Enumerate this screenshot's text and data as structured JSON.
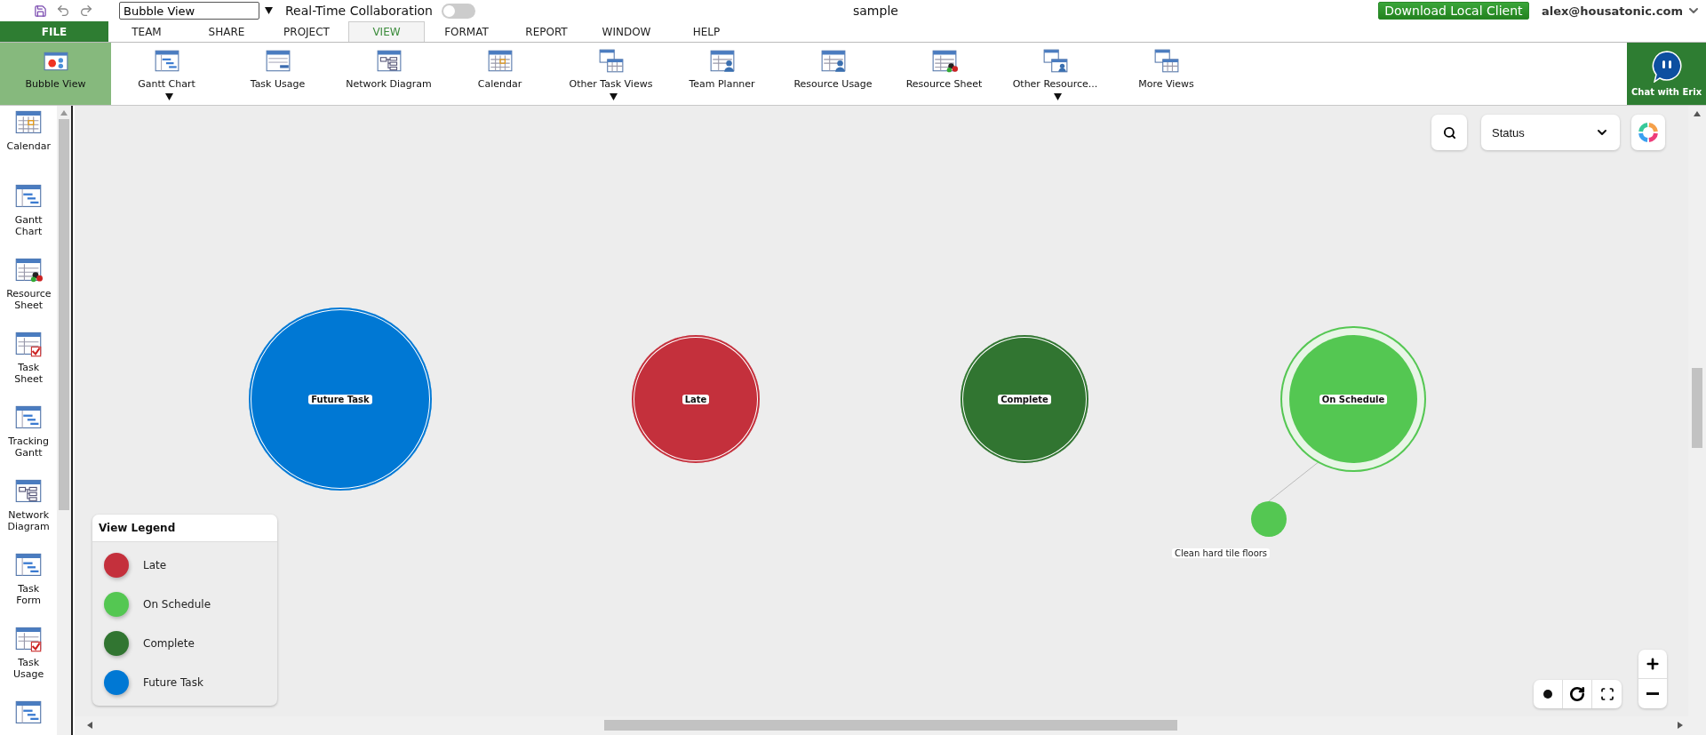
{
  "toolbar": {
    "document_name": "Bubble View",
    "collaboration_label": "Real-Time Collaboration",
    "collaboration_on": false
  },
  "title": "sample",
  "download_button": "Download Local Client",
  "user": "alex@housatonic.com",
  "menu_tabs": [
    {
      "label": "FILE",
      "kind": "file",
      "selected": false
    },
    {
      "label": "TEAM",
      "kind": "tab",
      "selected": false
    },
    {
      "label": "SHARE",
      "kind": "tab",
      "selected": false
    },
    {
      "label": "PROJECT",
      "kind": "tab",
      "selected": false
    },
    {
      "label": "VIEW",
      "kind": "tab",
      "selected": true
    },
    {
      "label": "FORMAT",
      "kind": "tab",
      "selected": false
    },
    {
      "label": "REPORT",
      "kind": "tab",
      "selected": false
    },
    {
      "label": "WINDOW",
      "kind": "tab",
      "selected": false
    },
    {
      "label": "HELP",
      "kind": "tab",
      "selected": false
    }
  ],
  "ribbon": [
    {
      "label": "Bubble View",
      "kind": "bubble",
      "selected": true,
      "dropdown": false
    },
    {
      "label": "Gantt Chart",
      "kind": "gantt",
      "selected": false,
      "dropdown": true
    },
    {
      "label": "Task Usage",
      "kind": "usage",
      "selected": false,
      "dropdown": false
    },
    {
      "label": "Network Diagram",
      "kind": "network",
      "selected": false,
      "dropdown": false
    },
    {
      "label": "Calendar",
      "kind": "calendar",
      "selected": false,
      "dropdown": false
    },
    {
      "label": "Other Task Views",
      "kind": "stack",
      "selected": false,
      "dropdown": true
    },
    {
      "label": "Team Planner",
      "kind": "team",
      "selected": false,
      "dropdown": false
    },
    {
      "label": "Resource Usage",
      "kind": "team",
      "selected": false,
      "dropdown": false
    },
    {
      "label": "Resource Sheet",
      "kind": "resource",
      "selected": false,
      "dropdown": false
    },
    {
      "label": "Other Resource...",
      "kind": "stackteam",
      "selected": false,
      "dropdown": true
    },
    {
      "label": "More Views",
      "kind": "stack",
      "selected": false,
      "dropdown": false
    }
  ],
  "chat_button": "Chat with Erix",
  "sidebar": [
    {
      "label": "Calendar",
      "kind": "calendar"
    },
    {
      "label": "Gantt Chart",
      "kind": "gantt"
    },
    {
      "label": "Resource Sheet",
      "kind": "resource"
    },
    {
      "label": "Task Sheet",
      "kind": "check"
    },
    {
      "label": "Tracking Gantt",
      "kind": "gantt"
    },
    {
      "label": "Network Diagram",
      "kind": "network"
    },
    {
      "label": "Task Form",
      "kind": "gantt"
    },
    {
      "label": "Task Usage",
      "kind": "check"
    }
  ],
  "canvas": {
    "group_by": "Status",
    "bubbles": [
      {
        "label": "Future Task",
        "color": "#0078d4",
        "highlighted": false
      },
      {
        "label": "Late",
        "color": "#c4303c",
        "highlighted": false
      },
      {
        "label": "Complete",
        "color": "#317531",
        "highlighted": false
      },
      {
        "label": "On Schedule",
        "color": "#54c752",
        "highlighted": true,
        "tasks": [
          {
            "label": "Clean hard tile floors",
            "color": "#54c752"
          }
        ]
      }
    ]
  },
  "legend": {
    "title": "View Legend",
    "items": [
      {
        "label": "Late",
        "color": "#c4303c"
      },
      {
        "label": "On Schedule",
        "color": "#54c752"
      },
      {
        "label": "Complete",
        "color": "#317531"
      },
      {
        "label": "Future Task",
        "color": "#0078d4"
      }
    ]
  }
}
